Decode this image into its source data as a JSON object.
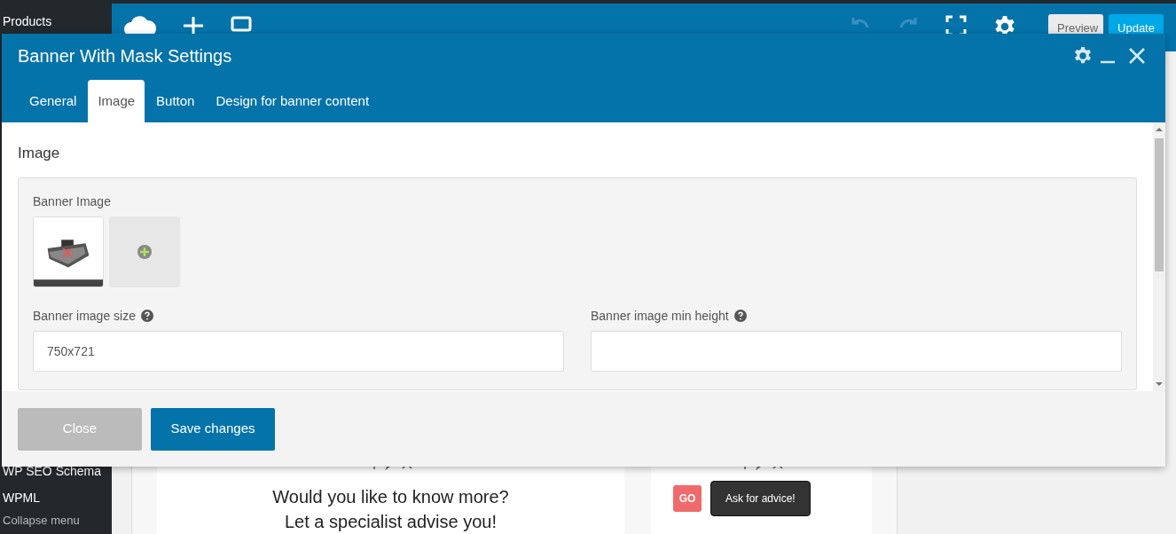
{
  "wp_sidebar": {
    "items": [
      {
        "label": "Products"
      },
      {
        "label": "WP SEO Schema"
      },
      {
        "label": "WPML"
      },
      {
        "label": "Collapse menu"
      }
    ]
  },
  "builder_toolbar": {
    "buttons": [
      {
        "label": "Preview",
        "kind": "secondary"
      },
      {
        "label": "Update",
        "kind": "primary"
      }
    ]
  },
  "modal": {
    "title": "Banner With Mask Settings",
    "tabs": [
      {
        "label": "General",
        "selected": false
      },
      {
        "label": "Image",
        "selected": true
      },
      {
        "label": "Button",
        "selected": false
      },
      {
        "label": "Design for banner content",
        "selected": false
      }
    ],
    "section_title": "Image",
    "banner_image": {
      "label": "Banner Image"
    },
    "fields": [
      {
        "label": "Banner image size",
        "value": "750x721"
      },
      {
        "label": "Banner image min height"
      }
    ],
    "buttons": [
      {
        "label": "Close",
        "kind": "secondary"
      },
      {
        "label": "Save changes",
        "kind": "primary"
      }
    ]
  },
  "page_content": {
    "text_lines": [
      "Would you like to know more?",
      "Let a specialist advise you!"
    ],
    "badge": "GO",
    "button": "Ask for advice!"
  }
}
